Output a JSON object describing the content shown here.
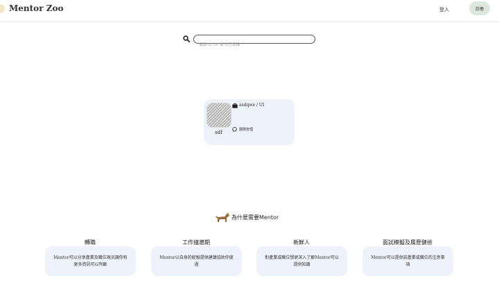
{
  "navbar": {
    "brand": "Mentor Zoo",
    "login_label": "登入",
    "register_label": "註冊"
  },
  "search": {
    "placeholder": "搜尋:UI UX 或 公司名稱",
    "icon": "search-icon"
  },
  "mentor_card": {
    "name": "sdf",
    "company_title": "asdqwe / UI",
    "topic": "團隊管理",
    "icons": [
      "briefcase-icon",
      "chat-icon"
    ]
  },
  "why_section": {
    "title": "為什麼需要Mentor",
    "icon": "dog-icon"
  },
  "features": [
    {
      "title": "轉職",
      "description": "Mentor可以分享產業及職位現況讓你有更多資訊可以判斷"
    },
    {
      "title": "工作撞牆期",
      "description": "Mentor以自身的經驗提供建議協助你度過"
    },
    {
      "title": "新鮮人",
      "description": "對產業或職位想更深入了解Mentor可以提供知識"
    },
    {
      "title": "面試模擬及履歷健檢",
      "description": "Mentor可以提供該產業或職位的注意事項"
    }
  ],
  "colors": {
    "card_background": "#eef2fb",
    "register_button": "#dde6df",
    "logo_dot": "#f4e7c8",
    "dog": "#9a6b3c"
  }
}
